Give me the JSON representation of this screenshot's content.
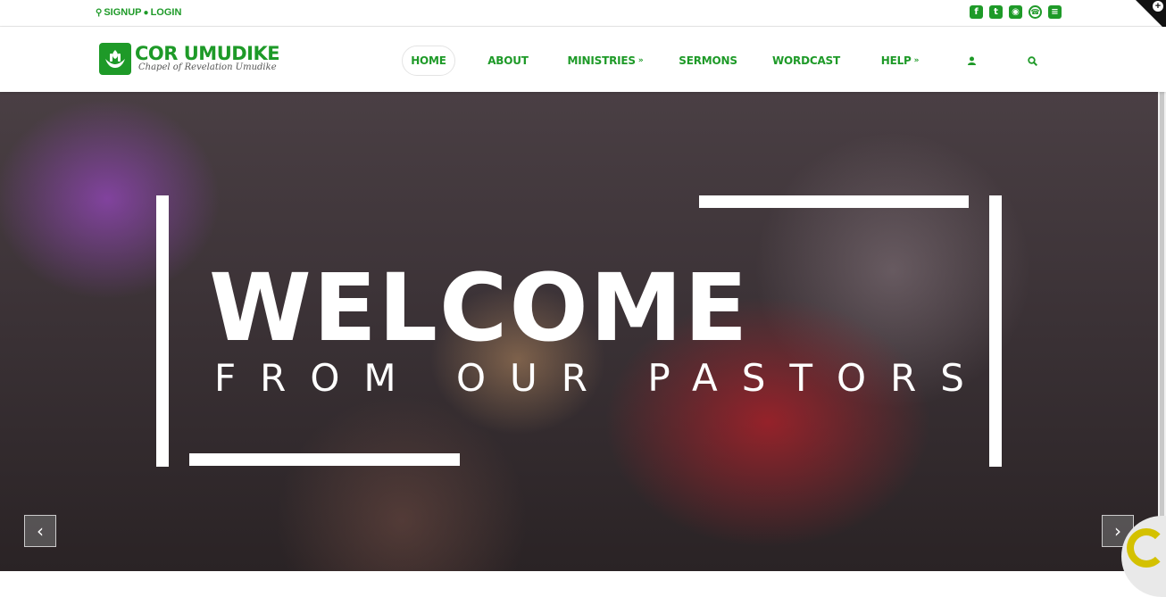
{
  "topbar": {
    "signup_label": "SIGNUP",
    "login_label": "LOGIN",
    "socials": [
      "facebook-icon",
      "twitter-icon",
      "instagram-icon",
      "whatsapp-icon",
      "rss-icon"
    ]
  },
  "brand": {
    "title": "COR UMUDIKE",
    "subtitle": "Chapel of Revelation Umudike"
  },
  "nav": {
    "items": [
      {
        "label": "HOME",
        "active": true
      },
      {
        "label": "ABOUT"
      },
      {
        "label": "MINISTRIES",
        "dropdown": true
      },
      {
        "label": "SERMONS"
      },
      {
        "label": "WORDCAST"
      },
      {
        "label": "HELP",
        "dropdown": true
      }
    ],
    "user_icon": "user-icon",
    "search_icon": "search-icon"
  },
  "hero": {
    "headline": "WELCOME",
    "subline": "FROM OUR PASTORS"
  },
  "colors": {
    "brand_green": "#1e9a28",
    "hero_text": "#ffffff"
  }
}
